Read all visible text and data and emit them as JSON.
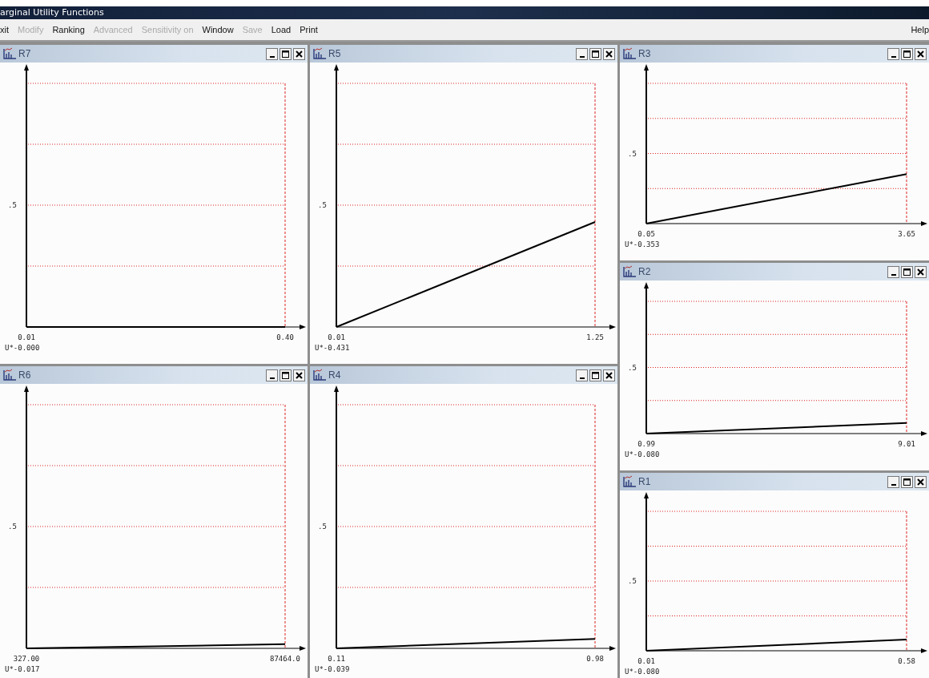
{
  "window": {
    "title": "arginal Utility Functions"
  },
  "menu": [
    {
      "label": "xit",
      "disabled": false
    },
    {
      "label": "Modify",
      "disabled": true
    },
    {
      "label": "Ranking",
      "disabled": false
    },
    {
      "label": "Advanced",
      "disabled": true
    },
    {
      "label": "Sensitivity on",
      "disabled": true
    },
    {
      "label": "Window",
      "disabled": false
    },
    {
      "label": "Save",
      "disabled": true
    },
    {
      "label": "Load",
      "disabled": false
    },
    {
      "label": "Print",
      "disabled": false
    }
  ],
  "help_menu": "Help",
  "left_windows": [
    {
      "title": "R7",
      "y_label": ".5",
      "x_labels": [
        "0.01",
        "0.40"
      ],
      "utility": "U*-0.000"
    },
    {
      "title": "R5",
      "y_label": ".5",
      "x_labels": [
        "0.01",
        "1.25"
      ],
      "utility": "U*-0.431"
    },
    {
      "title": "R6",
      "y_label": ".5",
      "x_labels": [
        "327.00",
        "87464.0"
      ],
      "utility": "U*-0.017"
    },
    {
      "title": "R4",
      "y_label": ".5",
      "x_labels": [
        "0.11",
        "0.98"
      ],
      "utility": "U*-0.039"
    }
  ],
  "right_windows": [
    {
      "title": "R3",
      "y_label": ".5",
      "x_labels": [
        "0.05",
        "3.65"
      ],
      "utility": "U*-0.353"
    },
    {
      "title": "R2",
      "y_label": ".5",
      "x_labels": [
        "0.99",
        "9.01"
      ],
      "utility": "U*-0.080"
    },
    {
      "title": "R1",
      "y_label": ".5",
      "x_labels": [
        "0.01",
        "0.58"
      ],
      "utility": "U*-0.080"
    }
  ]
}
